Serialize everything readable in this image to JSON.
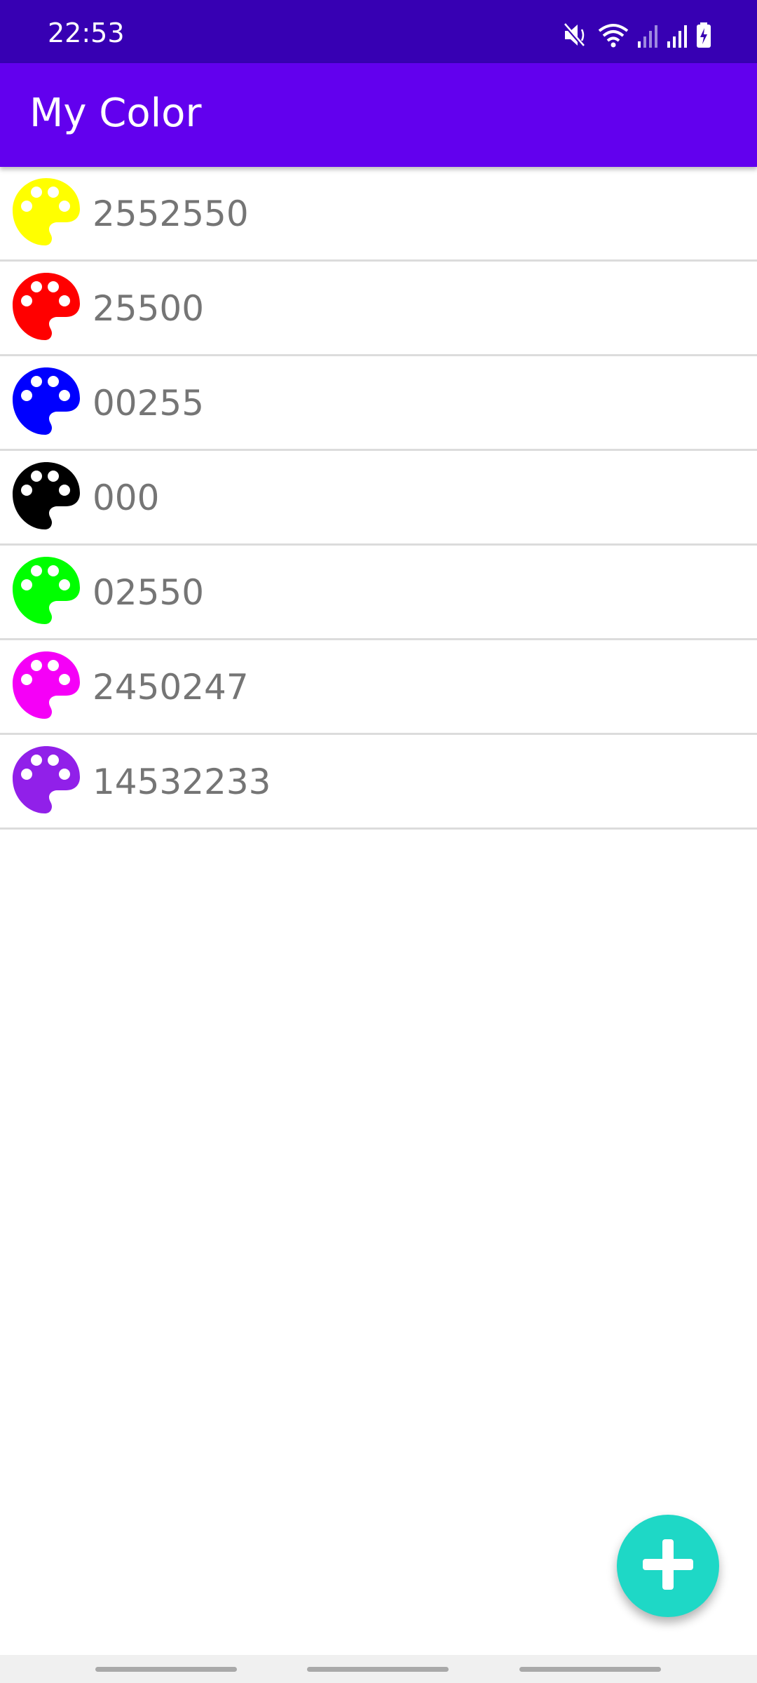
{
  "status_bar": {
    "time": "22:53",
    "icons": [
      "mute-icon",
      "wifi-icon",
      "signal-icon",
      "signal-icon",
      "battery-charging-icon"
    ]
  },
  "app_bar": {
    "title": "My Color",
    "color": "#6200ee"
  },
  "colors": [
    {
      "value": "2552550",
      "swatch": "#ffff00",
      "icon": "palette-icon"
    },
    {
      "value": "25500",
      "swatch": "#ff0000",
      "icon": "palette-icon"
    },
    {
      "value": "00255",
      "swatch": "#0000ff",
      "icon": "palette-icon"
    },
    {
      "value": "000",
      "swatch": "#000000",
      "icon": "palette-icon"
    },
    {
      "value": "02550",
      "swatch": "#00ff00",
      "icon": "palette-icon"
    },
    {
      "value": "2450247",
      "swatch": "#f500f7",
      "icon": "palette-icon"
    },
    {
      "value": "14532233",
      "swatch": "#9120e9",
      "icon": "palette-icon"
    }
  ],
  "fab": {
    "icon": "plus-icon",
    "color": "#1ed8c6"
  },
  "navigation": {
    "icons": [
      "recent-apps-pill",
      "home-pill",
      "back-pill"
    ]
  }
}
